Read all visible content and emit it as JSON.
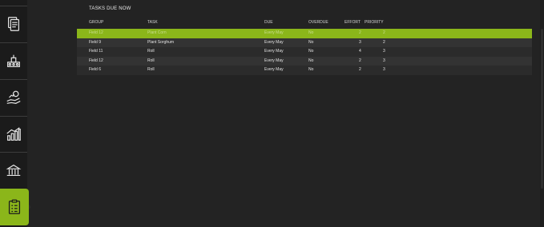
{
  "colors": {
    "accent": "#8bb61a",
    "background": "#232323",
    "sidebar": "#1b1b1b"
  },
  "sidebar": {
    "items": [
      {
        "icon": "documents-icon",
        "active": false
      },
      {
        "icon": "factory-icon",
        "active": false
      },
      {
        "icon": "hand-coin-icon",
        "active": false
      },
      {
        "icon": "bar-chart-growth-icon",
        "active": false
      },
      {
        "icon": "city-hall-icon",
        "active": false
      },
      {
        "icon": "clipboard-tasks-icon",
        "active": true
      }
    ]
  },
  "main": {
    "title": "TASKS DUE NOW",
    "columns": {
      "group": "GROUP",
      "task": "TASK",
      "due": "DUE",
      "overdue": "OVERDUE",
      "effort": "EFFORT",
      "priority": "PRIORITY"
    },
    "rows": [
      {
        "group": "Field 12",
        "task": "Plant Corn",
        "due": "Every May",
        "overdue": "No",
        "effort": "2",
        "priority": "2"
      },
      {
        "group": "Field 9",
        "task": "Plant Sorghum",
        "due": "Every May",
        "overdue": "No",
        "effort": "3",
        "priority": "2"
      },
      {
        "group": "Field 11",
        "task": "Roll",
        "due": "Every May",
        "overdue": "No",
        "effort": "4",
        "priority": "3"
      },
      {
        "group": "Field 12",
        "task": "Roll",
        "due": "Every May",
        "overdue": "No",
        "effort": "2",
        "priority": "3"
      },
      {
        "group": "Field 6",
        "task": "Roll",
        "due": "Every May",
        "overdue": "No",
        "effort": "2",
        "priority": "3"
      }
    ]
  }
}
